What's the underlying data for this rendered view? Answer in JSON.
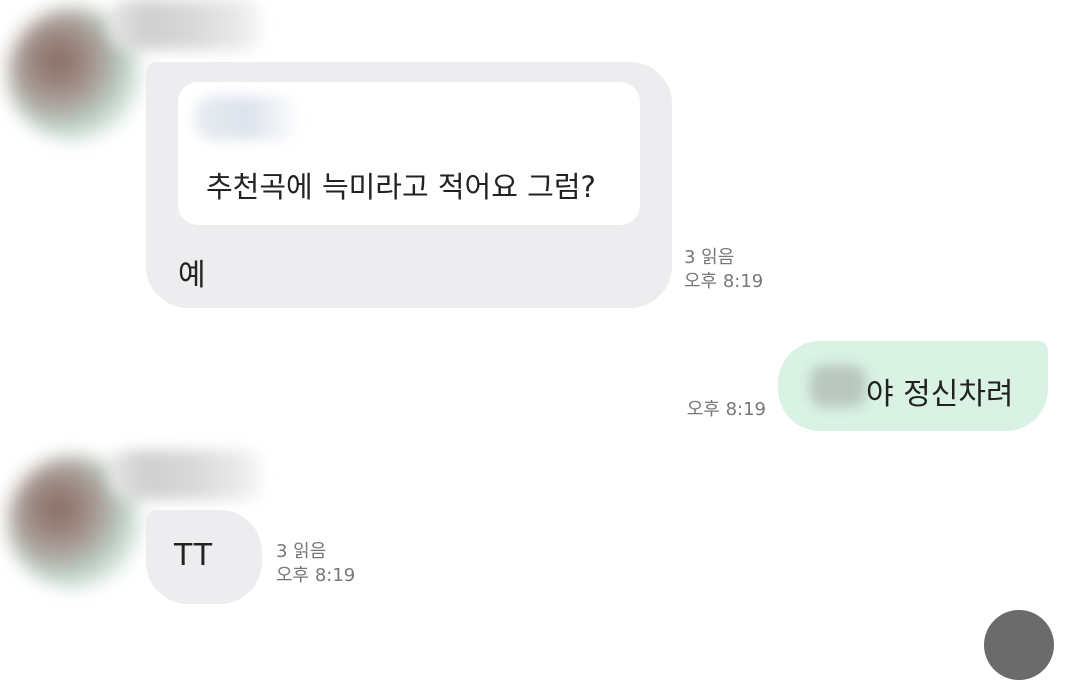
{
  "messages": [
    {
      "direction": "received",
      "sender_name": "",
      "quoted_text": "추천곡에 늑미라고 적어요 그럼?",
      "text": "예",
      "read_count": "3 읽음",
      "time": "오후 8:19"
    },
    {
      "direction": "sent",
      "text": "야 정신차려",
      "time": "오후 8:19"
    },
    {
      "direction": "received",
      "sender_name": "",
      "text": "TT",
      "read_count": "3 읽음",
      "time": "오후 8:19"
    }
  ],
  "colors": {
    "received_bubble": "#ededef",
    "sent_bubble": "#d9f2e4",
    "quote_card": "#ffffff",
    "meta_text": "#777777"
  },
  "icons": {
    "scroll_button": "scroll-down-icon"
  }
}
